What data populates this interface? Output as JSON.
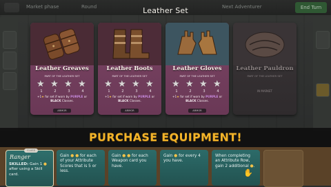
{
  "topbar": {
    "left_label": "Market phase",
    "mid_label": "Round",
    "right_label": "Next Adventurer",
    "button": "End Turn"
  },
  "overlay_title": "Leather Set",
  "cards": [
    {
      "name": "Leather Greaves",
      "subtitle": "PART OF THE LEATHER SET",
      "tiers": [
        "1",
        "2",
        "3",
        "4"
      ],
      "desc_pre": "+1",
      "desc_mid": " for set if worn by ",
      "desc_purple": "PURPLE",
      "desc_or": " or ",
      "desc_black": "BLACK",
      "desc_end": " Classes.",
      "tag": "ARMOR",
      "state": "available"
    },
    {
      "name": "Leather Boots",
      "subtitle": "PART OF THE LEATHER SET",
      "tiers": [
        "1",
        "2",
        "3",
        "4"
      ],
      "desc_pre": "+1",
      "desc_mid": " for set if worn by ",
      "desc_purple": "PURPLE",
      "desc_or": " or ",
      "desc_black": "BLACK",
      "desc_end": " Classes.",
      "tag": "ARMOR",
      "state": "available"
    },
    {
      "name": "Leather Gloves",
      "subtitle": "PART OF THE LEATHER SET",
      "tiers": [
        "1",
        "2",
        "3",
        "4"
      ],
      "desc_pre": "+1",
      "desc_mid": " for set if worn by ",
      "desc_purple": "PURPLE",
      "desc_or": " or ",
      "desc_black": "BLACK",
      "desc_end": " Classes.",
      "tag": "ARMOR",
      "state": "available"
    },
    {
      "name": "Leather Pauldron",
      "subtitle": "PART OF THE LEATHER SET",
      "market_label": "IN MARKET",
      "state": "in-market"
    }
  ],
  "banner": "PURCHASE EQUIPMENT!",
  "bottom": {
    "class_pill": "CLASS",
    "class_name": "Ranger",
    "class_text_bold": "SKILLED:",
    "class_text": " Gain 1 ",
    "class_text2": " after using a Skill card.",
    "cards": [
      {
        "text": "Gain ",
        "rest": " for each of your Attribute Scores that is 5 or less."
      },
      {
        "text": "Gain ",
        "rest": " for each Weapon card you have."
      },
      {
        "text": "Gain ",
        "rest": " for every 4 you have."
      },
      {
        "text": "When completing an Attribute Row, gain 2 additional ",
        "rest": "."
      }
    ]
  },
  "icons": {
    "star": "star-icon",
    "coin": "coin-icon",
    "hand": "hand-icon"
  },
  "colors": {
    "card_purple": "#7b4564",
    "banner_text": "#f2b329",
    "teal_card": "#2c6b69"
  }
}
